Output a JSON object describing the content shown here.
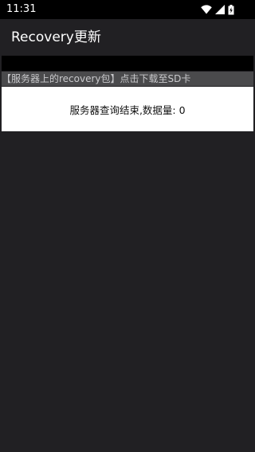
{
  "status_bar": {
    "time": "11:31",
    "icons": [
      "wifi-icon",
      "signal-icon",
      "battery-charging-icon"
    ]
  },
  "app_bar": {
    "title": "Recovery更新"
  },
  "list": {
    "info_text": "【服务器上的recovery包】点击下载至SD卡",
    "result_text": "服务器查询结束,数据量: 0"
  },
  "colors": {
    "background": "#212023",
    "status_bar": "#000000",
    "info_row": "#4a4a4c",
    "card": "#ffffff"
  }
}
